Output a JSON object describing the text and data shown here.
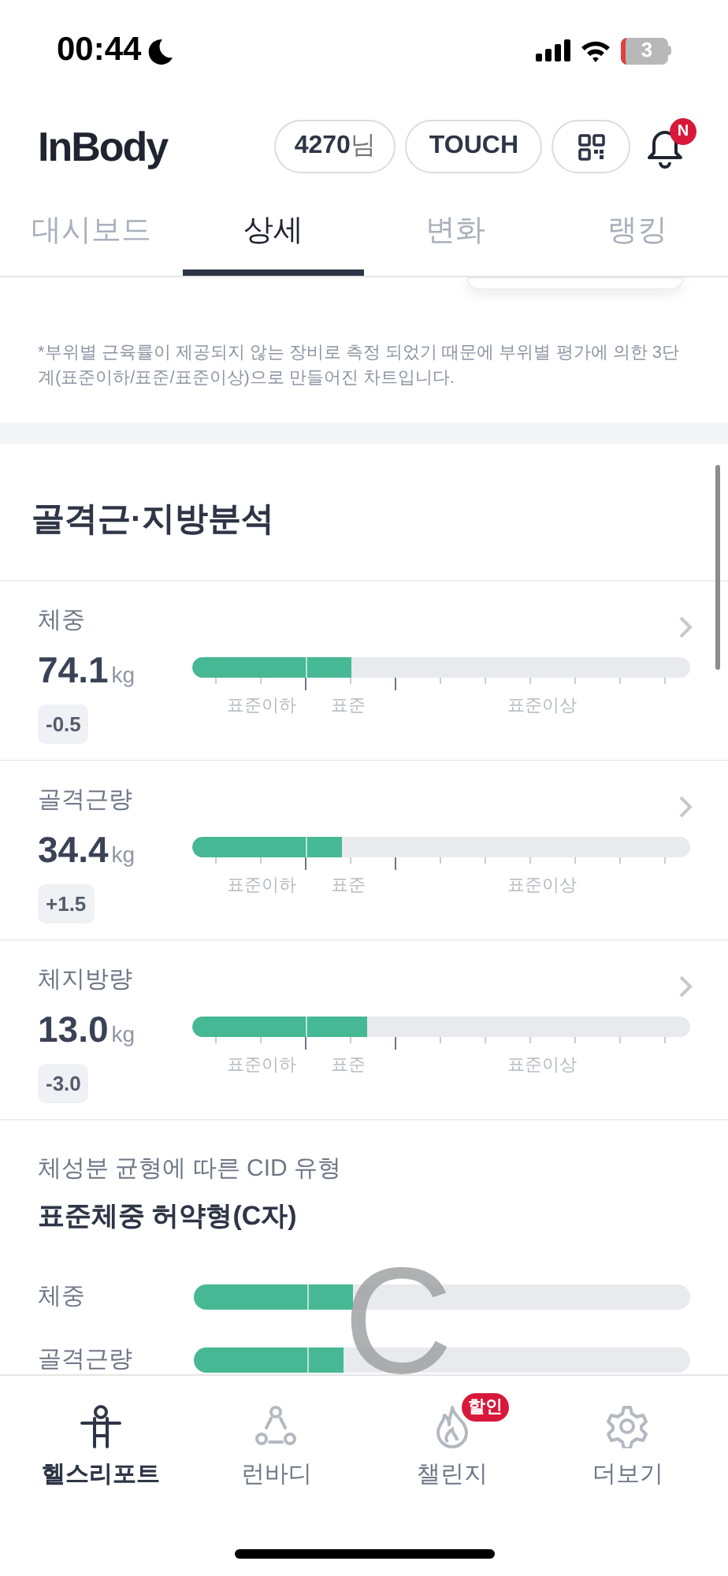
{
  "status_bar": {
    "time": "00:44",
    "battery": "3"
  },
  "header": {
    "logo": "InBody",
    "user": "4270",
    "user_suffix": "님",
    "touch_button": "TOUCH",
    "notification_badge": "N"
  },
  "tabs": [
    {
      "label": "대시보드",
      "selected": false
    },
    {
      "label": "상세",
      "selected": true
    },
    {
      "label": "변화",
      "selected": false
    },
    {
      "label": "랭킹",
      "selected": false
    }
  ],
  "note": "*부위별 근육률이 제공되지 않는 장비로 측정 되었기 때문에 부위별 평가에 의한 3단계(표준이하/표준/표준이상)으로 만들어진 차트입니다.",
  "section_title": "골격근·지방분석",
  "metrics": [
    {
      "name": "체중",
      "value": "74.1",
      "unit": "kg",
      "change": "-0.5",
      "level": 0.32,
      "scale_labels": [
        "표준이하",
        "표준",
        "표준이상"
      ]
    },
    {
      "name": "골격근량",
      "value": "34.4",
      "unit": "kg",
      "change": "+1.5",
      "level": 0.3,
      "scale_labels": [
        "표준이하",
        "표준",
        "표준이상"
      ]
    },
    {
      "name": "체지방량",
      "value": "13.0",
      "unit": "kg",
      "change": "-3.0",
      "level": 0.35,
      "scale_labels": [
        "표준이하",
        "표준",
        "표준이상"
      ]
    }
  ],
  "cid": {
    "caption": "체성분 균형에 따른 CID 유형",
    "type": "표준체중 허약형(C자)",
    "letter": "C",
    "rows": [
      {
        "name": "체중",
        "level": 0.32
      },
      {
        "name": "골격근량",
        "level": 0.3
      }
    ]
  },
  "bottom_nav": [
    {
      "label": "헬스리포트",
      "selected": true,
      "kind": "person"
    },
    {
      "label": "런바디",
      "selected": false,
      "kind": "nodes"
    },
    {
      "label": "챌린지",
      "selected": false,
      "kind": "flame",
      "badge": "할인"
    },
    {
      "label": "더보기",
      "selected": false,
      "kind": "gear"
    }
  ]
}
